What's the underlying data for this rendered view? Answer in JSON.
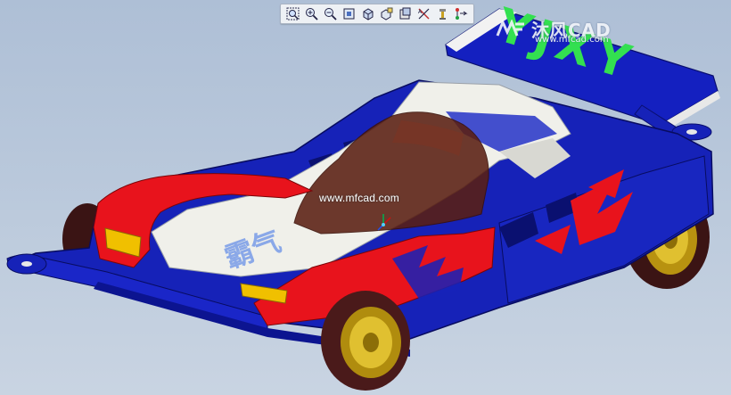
{
  "toolbar": {
    "buttons": [
      {
        "name": "zoom-window-icon",
        "title": "Zoom Window"
      },
      {
        "name": "zoom-in-icon",
        "title": "Zoom In"
      },
      {
        "name": "zoom-out-icon",
        "title": "Zoom Out"
      },
      {
        "name": "refit-icon",
        "title": "Refit"
      },
      {
        "name": "orient-icon",
        "title": "Orientation"
      },
      {
        "name": "saved-views-icon",
        "title": "Saved Views"
      },
      {
        "name": "layers-icon",
        "title": "Layers"
      },
      {
        "name": "datum-planes-icon",
        "title": "Datum Planes"
      },
      {
        "name": "datum-axes-icon",
        "title": "Datum Axes"
      },
      {
        "name": "datum-points-icon",
        "title": "Datum Points"
      }
    ]
  },
  "watermark": {
    "logo_text": "沐风CAD",
    "url": "www.mfcad.com"
  },
  "center_watermark": "www.mfcad.com",
  "model": {
    "wing_text": "YJXY",
    "hood_text": "霸气",
    "colors": {
      "body_blue": "#1622b8",
      "flame_red": "#e8131c",
      "panel_white": "#f0f0ea",
      "canopy_brown": "#5a1f12",
      "wheel_gold": "#c9a515",
      "tire_dark": "#4a1a1a",
      "wing_text_green": "#33e050",
      "headlight_yellow": "#f0c000"
    }
  }
}
